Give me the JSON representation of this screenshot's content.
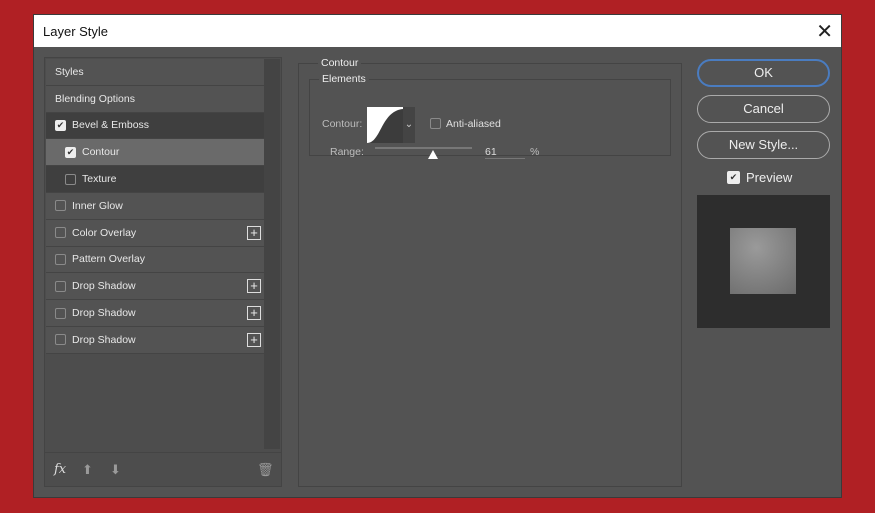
{
  "title": "Layer Style",
  "styles_list": [
    {
      "label": "Styles"
    },
    {
      "label": "Blending Options"
    },
    {
      "label": "Bevel & Emboss",
      "checked": true
    },
    {
      "label": "Contour",
      "checked": true
    },
    {
      "label": "Texture",
      "checked": false
    },
    {
      "label": "Inner Glow",
      "checked": false
    },
    {
      "label": "Color Overlay",
      "checked": false
    },
    {
      "label": "Pattern Overlay",
      "checked": false
    },
    {
      "label": "Drop Shadow",
      "checked": false
    },
    {
      "label": "Drop Shadow",
      "checked": false
    },
    {
      "label": "Drop Shadow",
      "checked": false
    }
  ],
  "footer": {
    "fx": "fx"
  },
  "contour": {
    "group": "Contour",
    "elements": "Elements",
    "contour_label": "Contour:",
    "anti_aliased": "Anti-aliased",
    "range_label": "Range:",
    "range_value": "61",
    "range_unit": "%",
    "range_percent": 61
  },
  "buttons": {
    "ok": "OK",
    "cancel": "Cancel",
    "new_style": "New Style...",
    "preview": "Preview"
  }
}
